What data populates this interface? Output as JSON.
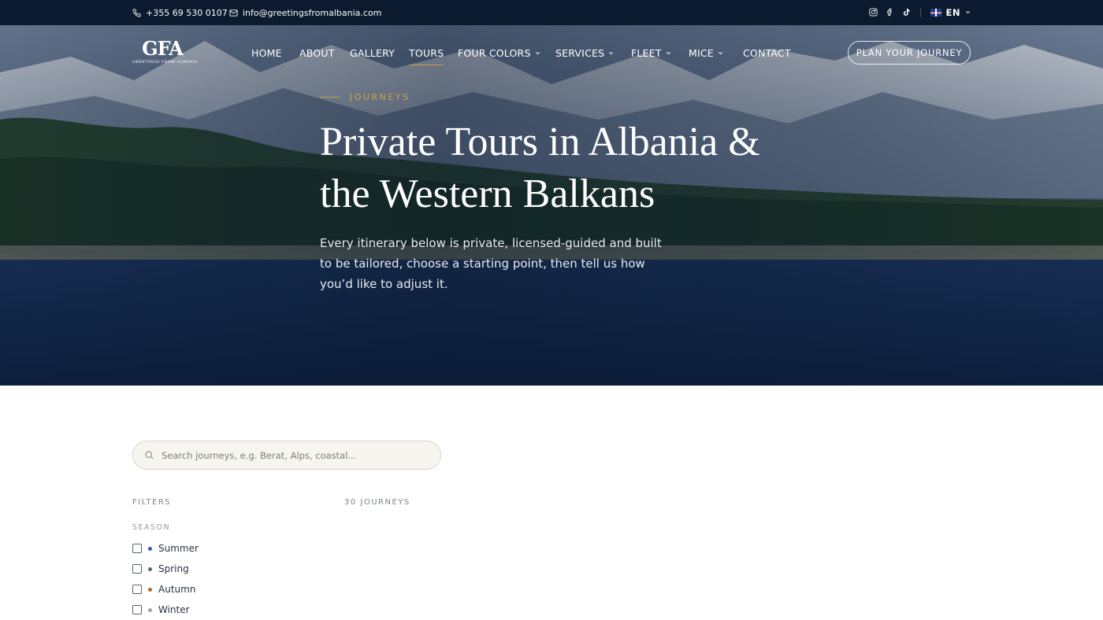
{
  "topbar": {
    "phone": "+355 69 530 0107",
    "email": "info@greetingsfromalbania.com",
    "socials": [
      "instagram-icon",
      "facebook-icon",
      "tiktok-icon"
    ],
    "language": "EN"
  },
  "header": {
    "logo_mark": "GFA",
    "logo_tagline": "GREETINGS FROM ALBANIA",
    "nav": [
      {
        "label": "HOME",
        "dropdown": false
      },
      {
        "label": "ABOUT",
        "dropdown": false
      },
      {
        "label": "GALLERY",
        "dropdown": false
      },
      {
        "label": "TOURS",
        "dropdown": false,
        "active": true
      },
      {
        "label": "FOUR COLORS",
        "dropdown": true
      },
      {
        "label": "SERVICES",
        "dropdown": true
      },
      {
        "label": "FLEET",
        "dropdown": true
      },
      {
        "label": "MICE",
        "dropdown": true
      },
      {
        "label": "CONTACT",
        "dropdown": false
      }
    ],
    "cta": "PLAN YOUR JOURNEY"
  },
  "hero": {
    "eyebrow": "JOURNEYS",
    "title_line1": "Private Tours in Albania &",
    "title_line2": "the Western Balkans",
    "lede": "Every itinerary below is private, licensed-guided and built to be tailored, choose a starting point, then tell us how you’d like to adjust it."
  },
  "search": {
    "placeholder": "Search journeys, e.g. Berat, Alps, coastal..."
  },
  "filters": {
    "heading": "FILTERS",
    "season_heading": "SEASON",
    "season_options": [
      {
        "label": "Summer",
        "dot_color": "#2e5aa8",
        "checked": false
      },
      {
        "label": "Spring",
        "dot_color": "#3f7a45",
        "checked": false
      },
      {
        "label": "Autumn",
        "dot_color": "#b0672c",
        "checked": false
      },
      {
        "label": "Winter",
        "dot_color": "#9aa4b0",
        "checked": false
      }
    ]
  },
  "results": {
    "count_label": "30 JOURNEYS"
  },
  "colors": {
    "topbar": "#0b1a2e",
    "accent_gold": "#c9a24a"
  }
}
